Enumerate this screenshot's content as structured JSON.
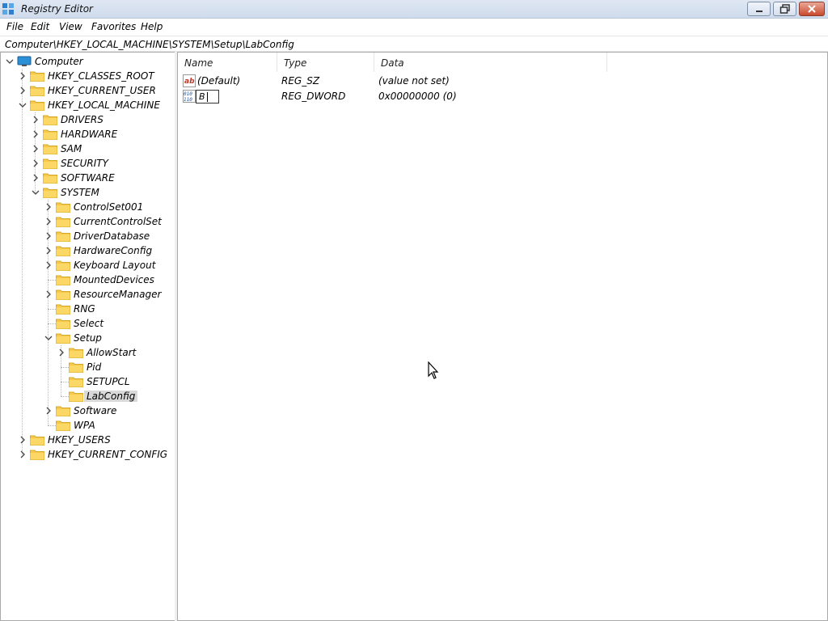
{
  "window": {
    "title": "Registry Editor"
  },
  "menu": [
    "File",
    "Edit",
    "View",
    "Favorites",
    "Help"
  ],
  "address": "Computer\\HKEY_LOCAL_MACHINE\\SYSTEM\\Setup\\LabConfig",
  "tree": [
    {
      "label": "Computer",
      "level": 0,
      "expander": "open",
      "icon": "computer-icon"
    },
    {
      "label": "HKEY_CLASSES_ROOT",
      "level": 1,
      "expander": "closed"
    },
    {
      "label": "HKEY_CURRENT_USER",
      "level": 1,
      "expander": "closed"
    },
    {
      "label": "HKEY_LOCAL_MACHINE",
      "level": 1,
      "expander": "open"
    },
    {
      "label": "DRIVERS",
      "level": 2,
      "expander": "closed"
    },
    {
      "label": "HARDWARE",
      "level": 2,
      "expander": "closed"
    },
    {
      "label": "SAM",
      "level": 2,
      "expander": "closed"
    },
    {
      "label": "SECURITY",
      "level": 2,
      "expander": "closed"
    },
    {
      "label": "SOFTWARE",
      "level": 2,
      "expander": "closed"
    },
    {
      "label": "SYSTEM",
      "level": 2,
      "expander": "open"
    },
    {
      "label": "ControlSet001",
      "level": 3,
      "expander": "closed"
    },
    {
      "label": "CurrentControlSet",
      "level": 3,
      "expander": "closed"
    },
    {
      "label": "DriverDatabase",
      "level": 3,
      "expander": "closed"
    },
    {
      "label": "HardwareConfig",
      "level": 3,
      "expander": "closed"
    },
    {
      "label": "Keyboard Layout",
      "level": 3,
      "expander": "closed"
    },
    {
      "label": "MountedDevices",
      "level": 3,
      "expander": "none"
    },
    {
      "label": "ResourceManager",
      "level": 3,
      "expander": "closed"
    },
    {
      "label": "RNG",
      "level": 3,
      "expander": "none"
    },
    {
      "label": "Select",
      "level": 3,
      "expander": "none"
    },
    {
      "label": "Setup",
      "level": 3,
      "expander": "open"
    },
    {
      "label": "AllowStart",
      "level": 4,
      "expander": "closed"
    },
    {
      "label": "Pid",
      "level": 4,
      "expander": "none"
    },
    {
      "label": "SETUPCL",
      "level": 4,
      "expander": "none"
    },
    {
      "label": "LabConfig",
      "level": 4,
      "expander": "none",
      "selected": true
    },
    {
      "label": "Software",
      "level": 3,
      "expander": "closed"
    },
    {
      "label": "WPA",
      "level": 3,
      "expander": "none"
    },
    {
      "label": "HKEY_USERS",
      "level": 1,
      "expander": "closed"
    },
    {
      "label": "HKEY_CURRENT_CONFIG",
      "level": 1,
      "expander": "closed"
    }
  ],
  "list": {
    "columns": [
      "Name",
      "Type",
      "Data"
    ],
    "rows": [
      {
        "name": "(Default)",
        "type": "REG_SZ",
        "data": "(value not set)",
        "icon": "string-value-icon"
      },
      {
        "name": "B",
        "type": "REG_DWORD",
        "data": "0x00000000 (0)",
        "icon": "binary-value-icon",
        "editing": true
      }
    ]
  },
  "colors": {
    "folder": "#f5c94a",
    "selection": "#d9d9d9",
    "computer": "#2b8fd6"
  }
}
